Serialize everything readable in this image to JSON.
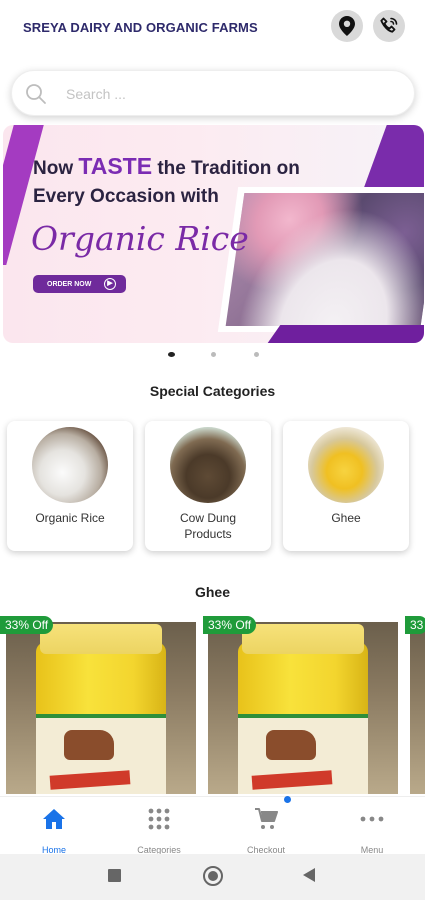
{
  "header": {
    "brand": "SREYA DAIRY AND ORGANIC FARMS",
    "location_icon": "location-pin-icon",
    "call_icon": "phone-call-icon"
  },
  "search": {
    "placeholder": "Search ...",
    "icon": "search-icon"
  },
  "banner": {
    "line1_prefix": "Now ",
    "line1_highlight": "TASTE",
    "line1_suffix": " the Tradition on",
    "line2": "Every Occasion with",
    "line3": "Organic Rice",
    "cta": "ORDER NOW",
    "slide_count": 3,
    "active_slide": 1
  },
  "special_categories": {
    "title": "Special Categories",
    "items": [
      {
        "label": "Organic Rice"
      },
      {
        "label": "Cow Dung Products"
      },
      {
        "label": "Ghee"
      }
    ]
  },
  "ghee_section": {
    "title": "Ghee",
    "products": [
      {
        "badge": "33% Off"
      },
      {
        "badge": "33% Off"
      },
      {
        "badge": "33"
      }
    ]
  },
  "bottom_nav": {
    "items": [
      {
        "label": "Home",
        "icon": "home-icon",
        "active": true
      },
      {
        "label": "Categories",
        "icon": "grid-icon",
        "active": false
      },
      {
        "label": "Checkout",
        "icon": "cart-icon",
        "active": false
      },
      {
        "label": "Menu",
        "icon": "more-dots-icon",
        "active": false
      }
    ]
  },
  "colors": {
    "brand_text": "#2e2a6b",
    "accent_purple": "#7b2cb3",
    "badge_green": "#1f9b3a",
    "nav_active": "#1a73e8"
  }
}
